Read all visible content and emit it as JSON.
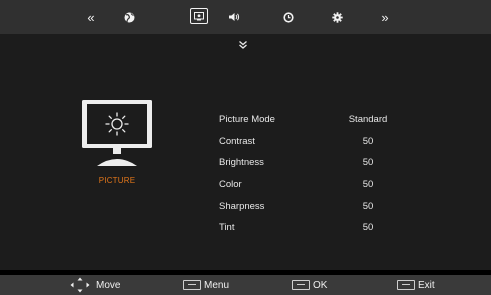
{
  "top_tabs": [
    {
      "icon": "chevron-double-left-icon",
      "glyph": "«",
      "active": false
    },
    {
      "icon": "globe-icon",
      "glyph": "",
      "active": false
    },
    {
      "icon": "picture-tab-icon",
      "glyph": "",
      "active": true
    },
    {
      "icon": "speaker-icon",
      "glyph": "",
      "active": false
    },
    {
      "icon": "clock-icon",
      "glyph": "",
      "active": false
    },
    {
      "icon": "gear-icon",
      "glyph": "",
      "active": false
    },
    {
      "icon": "chevron-double-right-icon",
      "glyph": "»",
      "active": false
    }
  ],
  "panel": {
    "caption": "PICTURE",
    "accent_color": "#e0751a",
    "settings": [
      {
        "label": "Picture Mode",
        "value": "Standard"
      },
      {
        "label": "Contrast",
        "value": "50"
      },
      {
        "label": "Brightness",
        "value": "50"
      },
      {
        "label": "Color",
        "value": "50"
      },
      {
        "label": "Sharpness",
        "value": "50"
      },
      {
        "label": "Tint",
        "value": "50"
      }
    ]
  },
  "bottom_bar": {
    "move": "Move",
    "menu": "Menu",
    "ok": "OK",
    "exit": "Exit"
  }
}
